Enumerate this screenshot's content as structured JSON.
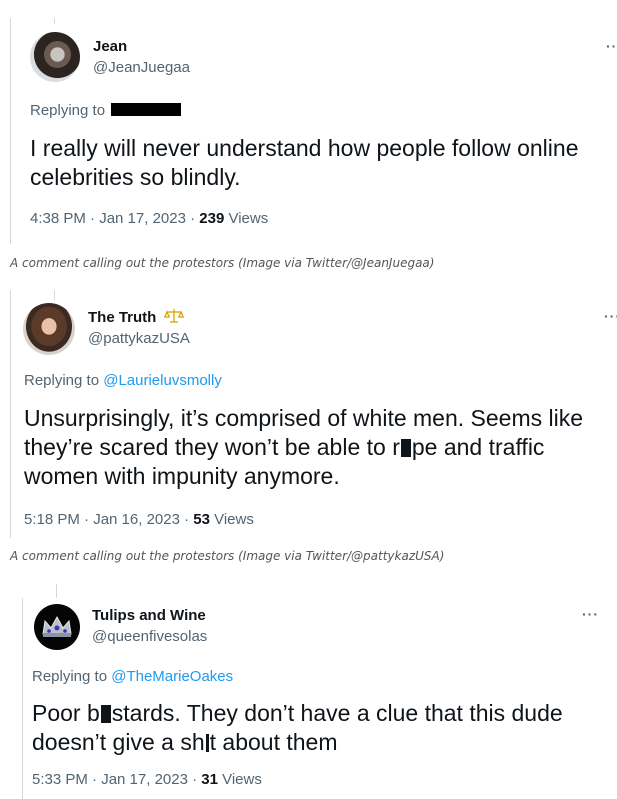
{
  "tweets": [
    {
      "name": "Jean",
      "handle": "@JeanJuegaa",
      "replying_prefix": "Replying to",
      "replying_to": "",
      "text": "I really will never understand how people follow online celebrities so blindly.",
      "time": "4:38 PM · Jan 17, 2023 · ",
      "views_count": "239",
      "views_label": " Views",
      "more": "··"
    },
    {
      "name": "The Truth",
      "name_icon": "scales-icon",
      "handle": "@pattykazUSA",
      "replying_prefix": "Replying to ",
      "replying_to": "@Laurieluvsmolly",
      "text_a": "Unsurprisingly, it’s comprised of white men. Seems like they’re scared they won’t be able to r",
      "text_b": "pe and traffic women with impunity anymore.",
      "time": "5:18 PM · Jan 16, 2023 · ",
      "views_count": "53",
      "views_label": " Views",
      "more": "···"
    },
    {
      "name": "Tulips and Wine",
      "handle": "@queenfivesolas",
      "replying_prefix": "Replying to ",
      "replying_to": "@TheMarieOakes",
      "text_a": "Poor b",
      "text_b": "stards. They don’t have a clue that this dude doesn’t give a sh",
      "text_c": "t about them",
      "time": "5:33 PM · Jan 17, 2023 · ",
      "views_count": "31",
      "views_label": " Views",
      "more": "···"
    }
  ],
  "captions": [
    "A comment calling out the protestors (Image via Twitter/@JeanJuegaa)",
    "A comment calling out the protestors (Image via Twitter/@pattykazUSA)"
  ],
  "colors": {
    "link": "#1d9bf0",
    "secondary": "#536471",
    "text": "#0f1419"
  }
}
